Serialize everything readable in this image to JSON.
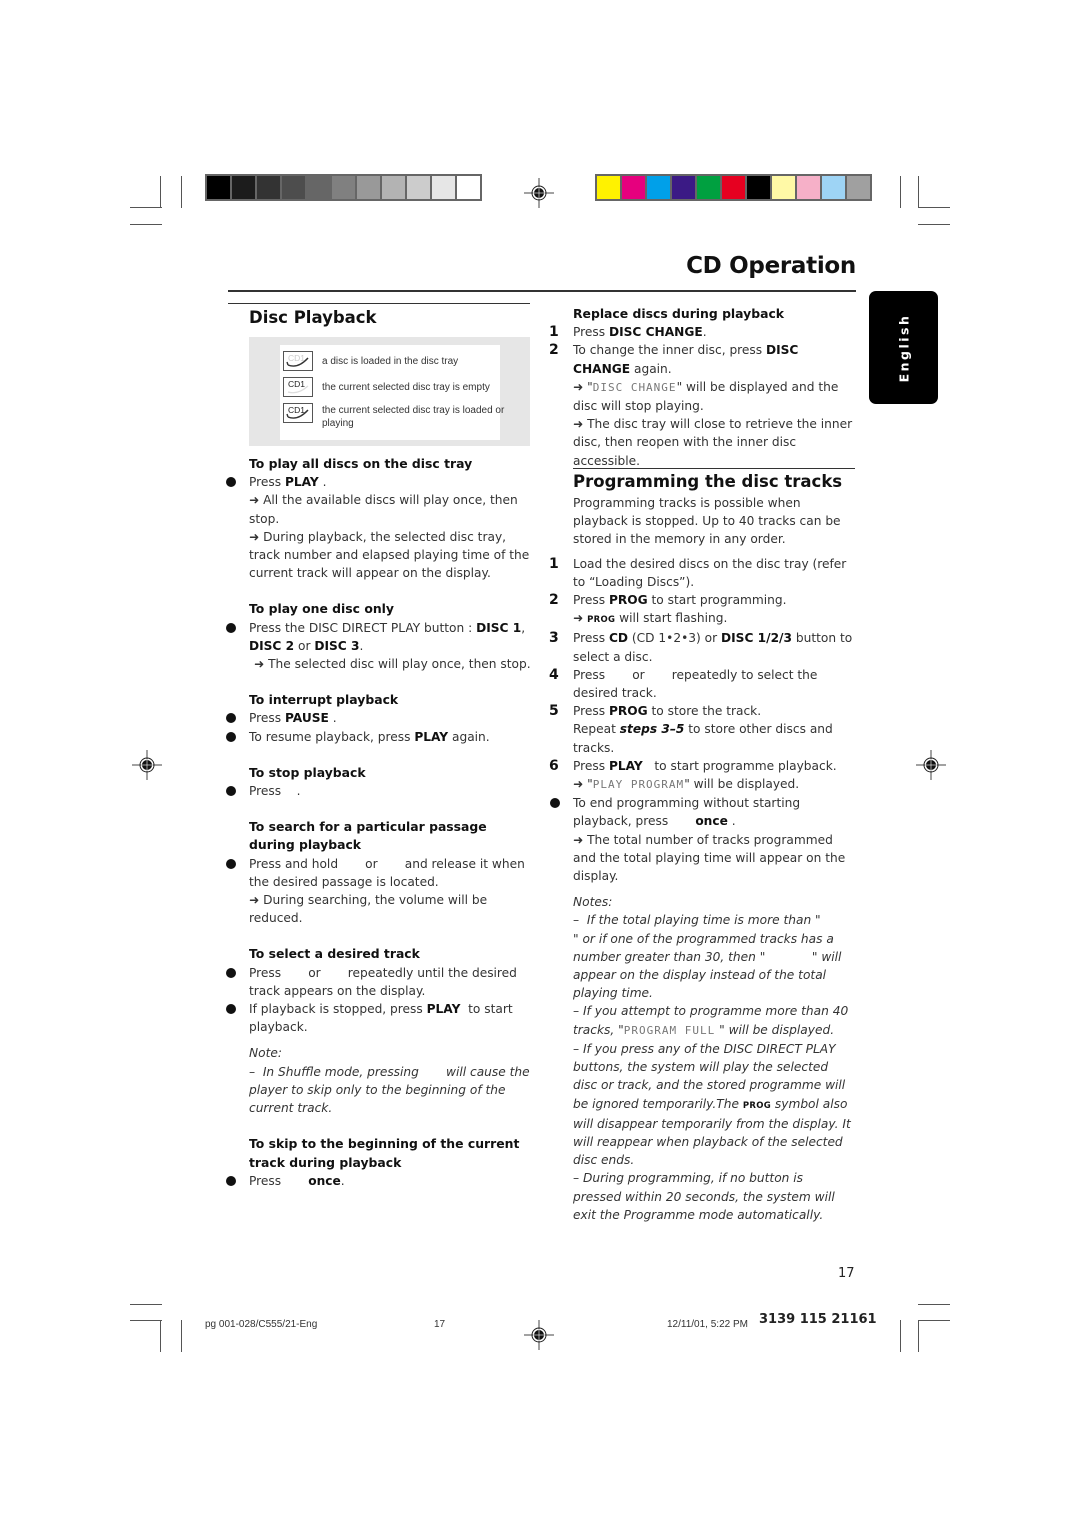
{
  "header": {
    "grayscale_swatches": [
      "#000000",
      "#1c1c1c",
      "#333333",
      "#4d4d4d",
      "#666666",
      "#808080",
      "#999999",
      "#b3b3b3",
      "#cccccc",
      "#e6e6e6",
      "#ffffff"
    ],
    "color_swatches": [
      "#fff200",
      "#e6007e",
      "#00a0e9",
      "#3b1a85",
      "#00a040",
      "#e60020",
      "#000000",
      "#fff9a6",
      "#f6b0c8",
      "#9ed4f5",
      "#a0a0a0"
    ],
    "page_title": "CD Operation"
  },
  "side_tab": {
    "label": "English"
  },
  "disc_playback": {
    "heading": "Disc Playback",
    "legend": [
      {
        "icon": "disc-loaded-icon",
        "icon_label": "CD1",
        "text": "a disc is loaded in the disc tray"
      },
      {
        "icon": "tray-empty-icon",
        "icon_label": "CD1",
        "text": "the current selected disc tray is empty"
      },
      {
        "icon": "tray-loaded-icon",
        "icon_label": "CD1",
        "text": "the current selected disc tray is loaded or playing"
      }
    ],
    "play_all": {
      "title": "To play all discs on the disc tray",
      "press": "Press ",
      "play": "PLAY",
      "end": " .",
      "result1": "➜ All the available discs will play once, then stop.",
      "result2": "➜ During playback, the selected disc tray, track number and elapsed playing time of the current track will appear on the display."
    },
    "play_one": {
      "title": "To play one disc only",
      "t1": "Press the DISC DIRECT PLAY button : ",
      "disc1": "DISC 1",
      "t2": ", ",
      "disc2": "DISC 2",
      "t3": " or ",
      "disc3": "DISC 3",
      "t4": ".",
      "result": "➜ The selected disc will play once, then stop."
    },
    "interrupt": {
      "title": "To interrupt playback",
      "press": "Press ",
      "pause": "PAUSE",
      "end": " .",
      "resume1": "To resume playback, press ",
      "play": "PLAY",
      "resume2": "  again."
    },
    "stop": {
      "title": "To stop playback",
      "text": "Press    ."
    },
    "search": {
      "title": "To search for a particular passage during playback",
      "text": "Press and hold       or       and release it when the desired passage is located.",
      "result": "➜ During searching, the volume will be reduced."
    },
    "select": {
      "title": "To select a desired track",
      "text1": "Press       or       repeatedly until the desired track appears on the display.",
      "text2a": "If playback is stopped, press ",
      "play": "PLAY",
      "text2b": "  to start playback.",
      "note_label": "Note:",
      "note": "–  In Shuffle mode, pressing       will cause the player to skip only to the beginning of the current track."
    },
    "skip": {
      "title": "To skip to the beginning of the current track during playback",
      "press": "Press       ",
      "once": "once",
      "end": "."
    }
  },
  "replace": {
    "title": "Replace discs during playback",
    "steps": [
      {
        "num": "1",
        "a": "Press ",
        "b": "DISC CHANGE",
        "c": "."
      },
      {
        "num": "2",
        "a": "To change the inner disc, press ",
        "b": "DISC CHANGE",
        "c": " again."
      }
    ],
    "r1_pre": "➜ \"",
    "r1_lcd": "DISC CHANGE",
    "r1_post": "\" will be displayed and the disc will stop playing.",
    "r2": "➜ The disc tray will close to retrieve the inner disc, then reopen with the inner disc accessible."
  },
  "programming": {
    "heading": "Programming the disc tracks",
    "intro": "Programming tracks is possible when playback is stopped. Up to 40 tracks can be stored in the memory in any order.",
    "step1": "Load the desired discs on the disc tray (refer to “Loading Discs”).",
    "step2a": "Press ",
    "step2b": "PROG",
    "step2c": " to start programming.",
    "step2r_pre": "➜ ",
    "step2r_sc": "PROG",
    "step2r_post": " will start flashing.",
    "step3a": "Press ",
    "step3b": "CD",
    "step3c": " (CD 1•2•3) or ",
    "step3d": "DISC 1/2/3",
    "step3e": " button to select a disc.",
    "step4": "Press       or       repeatedly to select the desired track.",
    "step5a": "Press ",
    "step5b": "PROG",
    "step5c": " to store the track.",
    "step5r_a": "Repeat ",
    "step5r_b": "steps 3–5",
    "step5r_c": " to store other discs and tracks.",
    "step6a": "Press ",
    "step6b": "PLAY",
    "step6c": "   to start programme playback.",
    "step6r_pre": "➜ \"",
    "step6r_lcd": "PLAY PROGRAM",
    "step6r_post": "\" will be displayed.",
    "end_a": "To end programming without starting playback, press       ",
    "end_b": "once",
    "end_c": " .",
    "end_r": "➜ The total number of tracks programmed and the total playing time will appear on the display.",
    "notes_label": "Notes:",
    "note1": "–  If the total playing time is more than \"            \" or if one of the programmed tracks has a number greater than 30, then \"            \" will appear on the display instead of the total playing time.",
    "note2_pre": "–  If you attempt to programme more than 40 tracks, \"",
    "note2_lcd": "PROGRAM FULL",
    "note2_post": " \" will be displayed.",
    "note3_a": "–  If you press any of the DISC DIRECT PLAY buttons, the system will play the selected disc or track, and the stored programme will be ignored temporarily.The ",
    "note3_sc": "PROG",
    "note3_b": " symbol also will disappear temporarily from the display. It will reappear when playback of the selected disc ends.",
    "note4": "–  During programming, if no button is pressed within 20 seconds, the system will exit the Programme mode automatically."
  },
  "footer": {
    "page_number": "17",
    "file": "pg 001-028/C555/21-Eng",
    "file_page": "17",
    "datetime": "12/11/01, 5:22 PM",
    "code": "3139 115 21161"
  }
}
